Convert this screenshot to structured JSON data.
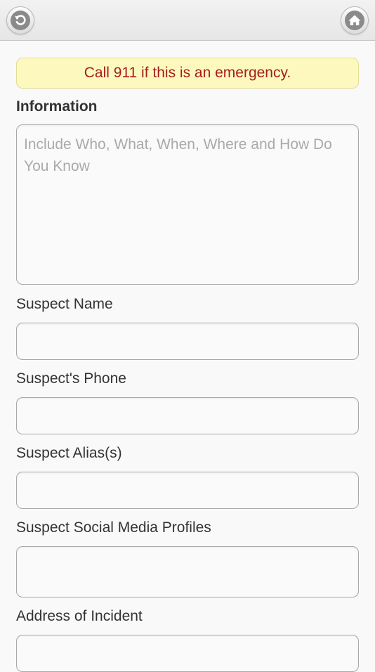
{
  "header": {
    "back_icon": "back-arrow-icon",
    "home_icon": "home-icon"
  },
  "colors": {
    "alert_background": "#fdf9be",
    "alert_text": "#a41e1e",
    "icon_gray": "#8a8a8a"
  },
  "alert": {
    "text": "Call 911 if this is an emergency."
  },
  "information": {
    "label": "Information",
    "placeholder": "Include Who, What, When, Where and How Do You Know",
    "value": ""
  },
  "fields": {
    "suspect_name": {
      "label": "Suspect Name",
      "value": ""
    },
    "suspect_phone": {
      "label": "Suspect's Phone",
      "value": ""
    },
    "suspect_alias": {
      "label": "Suspect Alias(s)",
      "value": ""
    },
    "suspect_social": {
      "label": "Suspect Social Media Profiles",
      "value": ""
    },
    "incident_address": {
      "label": "Address of Incident",
      "value": ""
    }
  }
}
